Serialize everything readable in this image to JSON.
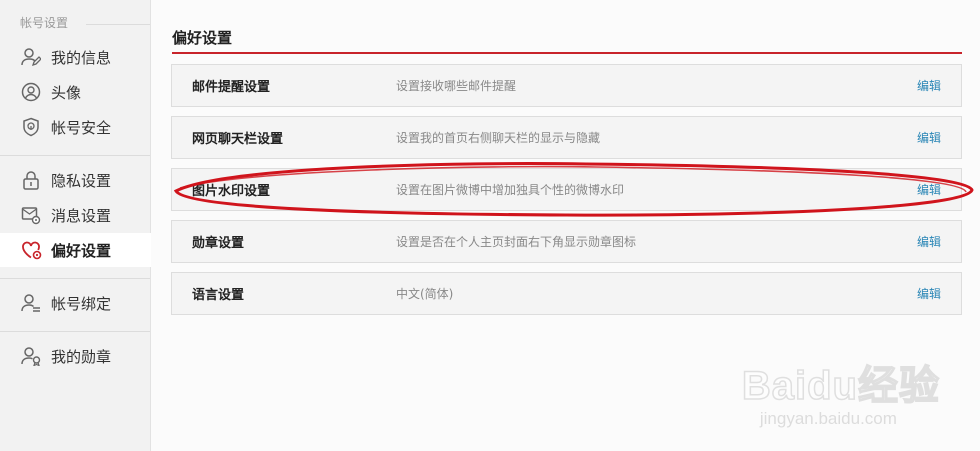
{
  "sidebar": {
    "section_title": "帐号设置",
    "items": [
      {
        "label": "我的信息",
        "icon": "user-edit-icon"
      },
      {
        "label": "头像",
        "icon": "avatar-icon"
      },
      {
        "label": "帐号安全",
        "icon": "shield-icon"
      },
      {
        "label": "隐私设置",
        "icon": "lock-icon"
      },
      {
        "label": "消息设置",
        "icon": "message-settings-icon"
      },
      {
        "label": "偏好设置",
        "icon": "heart-gear-icon"
      },
      {
        "label": "帐号绑定",
        "icon": "user-link-icon"
      },
      {
        "label": "我的勋章",
        "icon": "user-medal-icon"
      }
    ],
    "active_index": 5
  },
  "main": {
    "title": "偏好设置",
    "rows": [
      {
        "title": "邮件提醒设置",
        "desc": "设置接收哪些邮件提醒",
        "edit": "编辑"
      },
      {
        "title": "网页聊天栏设置",
        "desc": "设置我的首页右侧聊天栏的显示与隐藏",
        "edit": "编辑"
      },
      {
        "title": "图片水印设置",
        "desc": "设置在图片微博中增加独具个性的微博水印",
        "edit": "编辑"
      },
      {
        "title": "勋章设置",
        "desc": "设置是否在个人主页封面右下角显示勋章图标",
        "edit": "编辑"
      },
      {
        "title": "语言设置",
        "desc": "中文(简体)",
        "edit": "编辑"
      }
    ]
  },
  "watermark": {
    "logo": "Baidu经验",
    "url": "jingyan.baidu.com"
  },
  "colors": {
    "accent": "#c8242b",
    "link": "#2a86b6",
    "annotation": "#d0141c"
  }
}
